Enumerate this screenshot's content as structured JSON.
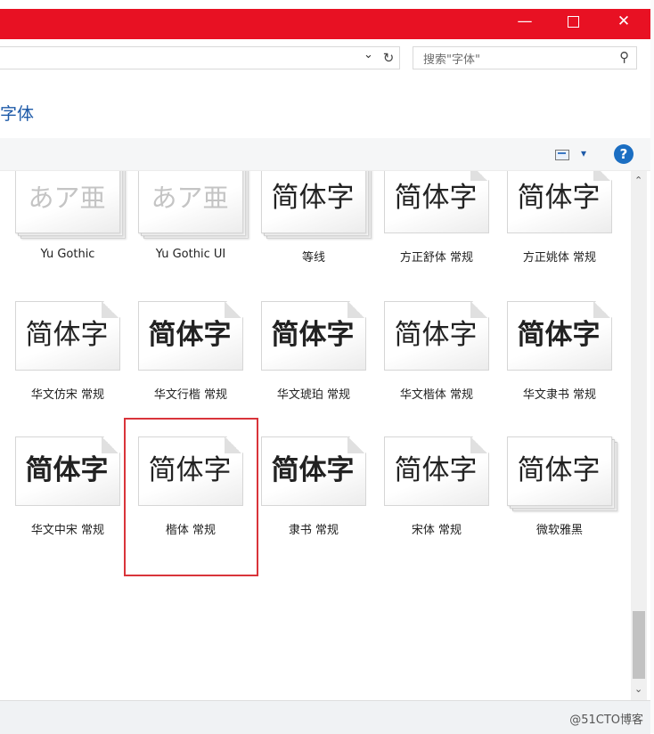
{
  "window": {
    "minimize_glyph": "—",
    "close_glyph": "✕"
  },
  "address_bar": {
    "dropdown_glyph": "⌄",
    "refresh_glyph": "↻"
  },
  "search": {
    "placeholder": "搜索\"字体\"",
    "icon_glyph": "⚲"
  },
  "breadcrumb": {
    "title": "字体"
  },
  "toolbar": {
    "view_dropdown_glyph": "▾",
    "help_glyph": "?"
  },
  "fonts": [
    {
      "sample": "あア亜",
      "name": "Yu Gothic",
      "style": "light stack"
    },
    {
      "sample": "あア亜",
      "name": "Yu Gothic UI",
      "style": "light stack"
    },
    {
      "sample": "简体字",
      "name": "等线",
      "style": "stack"
    },
    {
      "sample": "简体字",
      "name": "方正舒体 常规",
      "style": "normal"
    },
    {
      "sample": "简体字",
      "name": "方正姚体 常规",
      "style": "normal"
    },
    {
      "sample": "简体字",
      "name": "华文仿宋 常规",
      "style": "normal"
    },
    {
      "sample": "简体字",
      "name": "华文行楷 常规",
      "style": "bold"
    },
    {
      "sample": "简体字",
      "name": "华文琥珀 常规",
      "style": "bold"
    },
    {
      "sample": "简体字",
      "name": "华文楷体 常规",
      "style": "normal"
    },
    {
      "sample": "简体字",
      "name": "华文隶书 常规",
      "style": "bold"
    },
    {
      "sample": "简体字",
      "name": "华文中宋 常规",
      "style": "bold"
    },
    {
      "sample": "简体字",
      "name": "楷体 常规",
      "style": "normal"
    },
    {
      "sample": "简体字",
      "name": "隶书 常规",
      "style": "bold"
    },
    {
      "sample": "简体字",
      "name": "宋体 常规",
      "style": "normal"
    },
    {
      "sample": "简体字",
      "name": "微软雅黑",
      "style": "stack"
    }
  ],
  "scrollbar": {
    "up_glyph": "⌃",
    "down_glyph": "⌄"
  },
  "watermark": "@51CTO博客",
  "colors": {
    "titlebar": "#e81123",
    "highlight": "#d9343a",
    "link": "#1e5aa8"
  }
}
